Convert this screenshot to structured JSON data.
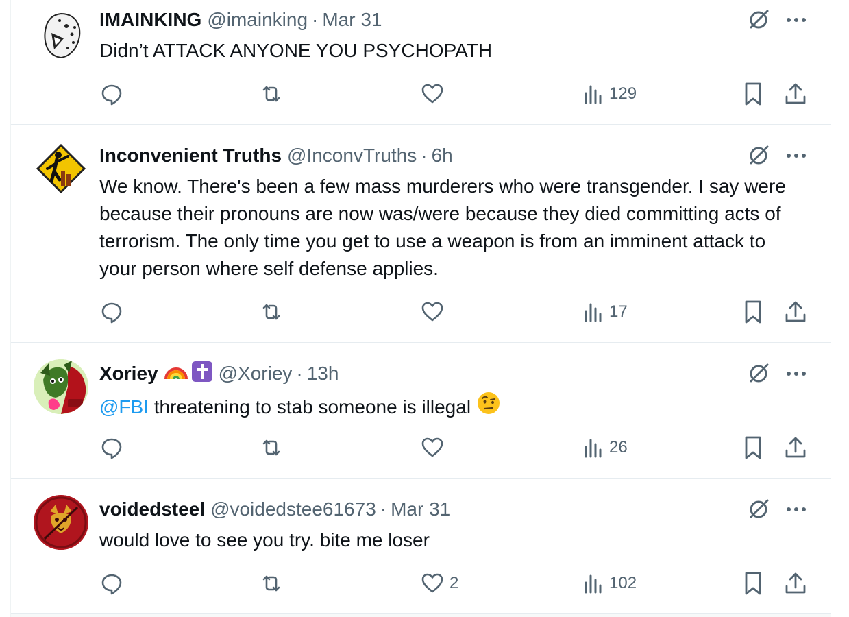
{
  "tweets": [
    {
      "display_name": "IMAINKING",
      "handle": "@imainking",
      "separator": "·",
      "time": "Mar 31",
      "text": "Didn’t ATTACK ANYONE YOU PSYCHOPATH",
      "views": "129",
      "likes": "",
      "avatar": "leopard-avatar"
    },
    {
      "display_name": "Inconvenient Truths",
      "handle": "@InconvTruths",
      "separator": "·",
      "time": "6h",
      "text": "We know. There's been a few mass murderers who were transgender. I say were because their pronouns are now was/were because they died committing acts of terrorism.  The only time you get to use a weapon is from an imminent attack to your person where self defense applies.",
      "views": "17",
      "likes": "",
      "avatar": "warning-sign-avatar"
    },
    {
      "display_name": "Xoriey",
      "handle": "@Xoriey",
      "separator": "·",
      "time": "13h",
      "mention": "@FBI",
      "text": " threatening to stab someone is illegal",
      "views": "26",
      "likes": "",
      "avatar": "character-avatar",
      "name_badges": [
        "rainbow-emoji",
        "latin-cross-emoji"
      ],
      "text_emoji": "face-with-raised-eyebrow-emoji"
    },
    {
      "display_name": "voidedsteel",
      "handle": "@voidedstee61673",
      "separator": "·",
      "time": "Mar 31",
      "text": "would love to see you try. bite me loser",
      "views": "102",
      "likes": "2",
      "avatar": "red-creature-avatar"
    }
  ],
  "icons": {
    "reply": "reply-icon",
    "repost": "repost-icon",
    "like": "heart-icon",
    "views": "views-icon",
    "bookmark": "bookmark-icon",
    "share": "share-icon",
    "grok": "grok-icon",
    "more": "more-icon"
  },
  "colors": {
    "text_primary": "#0f1419",
    "text_secondary": "#536471",
    "link": "#1d9bf0",
    "divider": "#e6ecf0"
  }
}
